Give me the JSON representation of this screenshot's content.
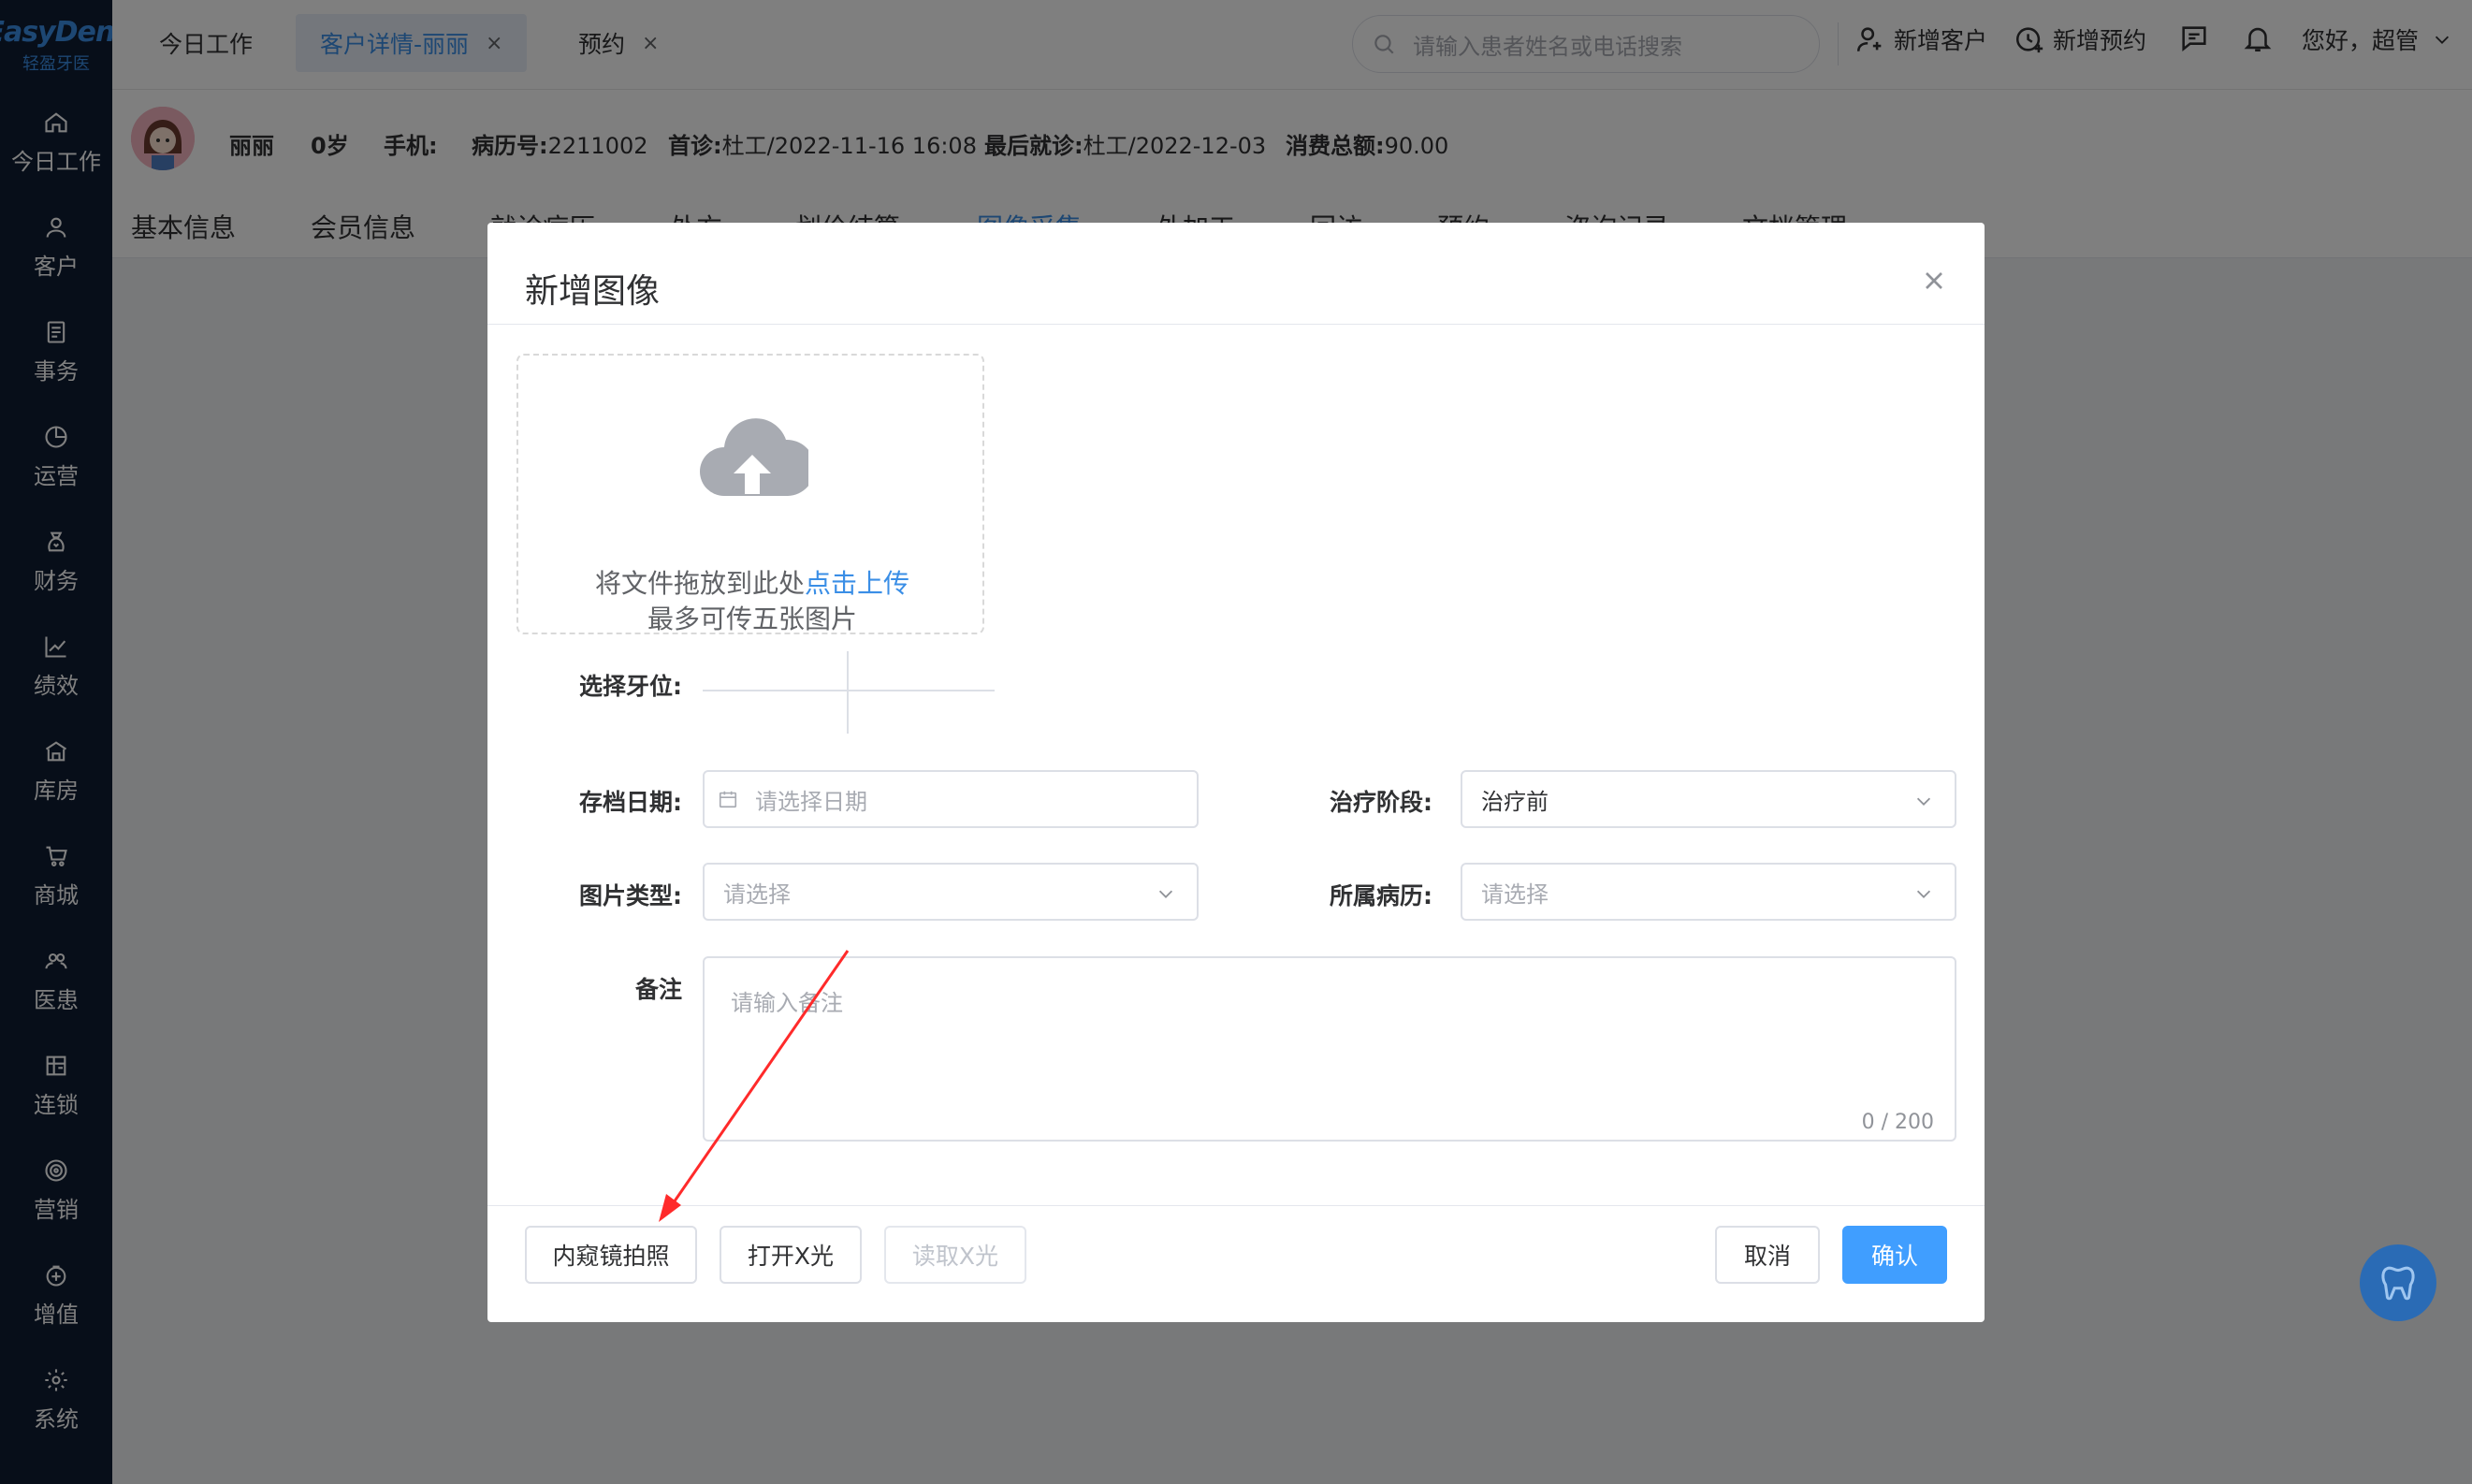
{
  "app": {
    "logo_en": "EasyDent",
    "logo_cn": "轻盈牙医"
  },
  "sidebar": {
    "items": [
      {
        "label": "今日工作",
        "icon": "home-icon"
      },
      {
        "label": "客户",
        "icon": "user-icon"
      },
      {
        "label": "事务",
        "icon": "document-icon"
      },
      {
        "label": "运营",
        "icon": "pie-chart-icon"
      },
      {
        "label": "财务",
        "icon": "money-bag-icon"
      },
      {
        "label": "绩效",
        "icon": "line-chart-icon"
      },
      {
        "label": "库房",
        "icon": "warehouse-icon"
      },
      {
        "label": "商城",
        "icon": "cart-icon"
      },
      {
        "label": "医患",
        "icon": "people-icon"
      },
      {
        "label": "连锁",
        "icon": "store-icon"
      },
      {
        "label": "营销",
        "icon": "target-icon"
      },
      {
        "label": "增值",
        "icon": "value-added-icon"
      },
      {
        "label": "系统",
        "icon": "gear-icon"
      }
    ]
  },
  "header": {
    "tabs": [
      {
        "label": "今日工作",
        "closable": false,
        "active": false
      },
      {
        "label": "客户详情-丽丽",
        "closable": true,
        "active": true
      },
      {
        "label": "预约",
        "closable": true,
        "active": false
      }
    ],
    "close_glyph": "×",
    "search_placeholder": "请输入患者姓名或电话搜索",
    "add_customer": "新增客户",
    "add_appointment": "新增预约",
    "greeting": "您好，超管"
  },
  "patient": {
    "name": "丽丽",
    "age": "0岁",
    "phone_label": "手机:",
    "record_label": "病历号:",
    "record_value": "2211002",
    "first_visit_label": "首诊:",
    "first_visit_value": "杜工/2022-11-16 16:08",
    "last_visit_label": "最后就诊:",
    "last_visit_value": "杜工/2022-12-03",
    "total_label": "消费总额:",
    "total_value": "90.00"
  },
  "subtabs": [
    {
      "label": "基本信息",
      "active": false
    },
    {
      "label": "会员信息",
      "active": false
    },
    {
      "label": "就诊病历",
      "active": false
    },
    {
      "label": "处方",
      "active": false
    },
    {
      "label": "划价结算",
      "active": false
    },
    {
      "label": "图像采集",
      "active": true
    },
    {
      "label": "外加工",
      "active": false
    },
    {
      "label": "回访",
      "active": false
    },
    {
      "label": "预约",
      "active": false
    },
    {
      "label": "咨询记录",
      "active": false
    },
    {
      "label": "文档管理",
      "active": false
    }
  ],
  "dialog": {
    "title": "新增图像",
    "upload": {
      "text_prefix": "将文件拖放到此处",
      "text_link": "点击上传",
      "hint": "最多可传五张图片"
    },
    "tooth_label": "选择牙位:",
    "archive_date": {
      "label": "存档日期:",
      "placeholder": "请选择日期"
    },
    "treatment_stage": {
      "label": "治疗阶段:",
      "value": "治疗前"
    },
    "image_type": {
      "label": "图片类型:",
      "placeholder": "请选择"
    },
    "medical_record": {
      "label": "所属病历:",
      "placeholder": "请选择"
    },
    "remark": {
      "label": "备注",
      "placeholder": "请输入备注",
      "count": "0 / 200"
    },
    "buttons": {
      "endoscope": "内窥镜拍照",
      "open_xray": "打开X光",
      "read_xray": "读取X光",
      "cancel": "取消",
      "confirm": "确认"
    }
  },
  "colors": {
    "sidebar_bg": "#0f1d33",
    "accent": "#409eff",
    "link": "#3a8ee6",
    "annotation_arrow": "#ff2a2a"
  }
}
